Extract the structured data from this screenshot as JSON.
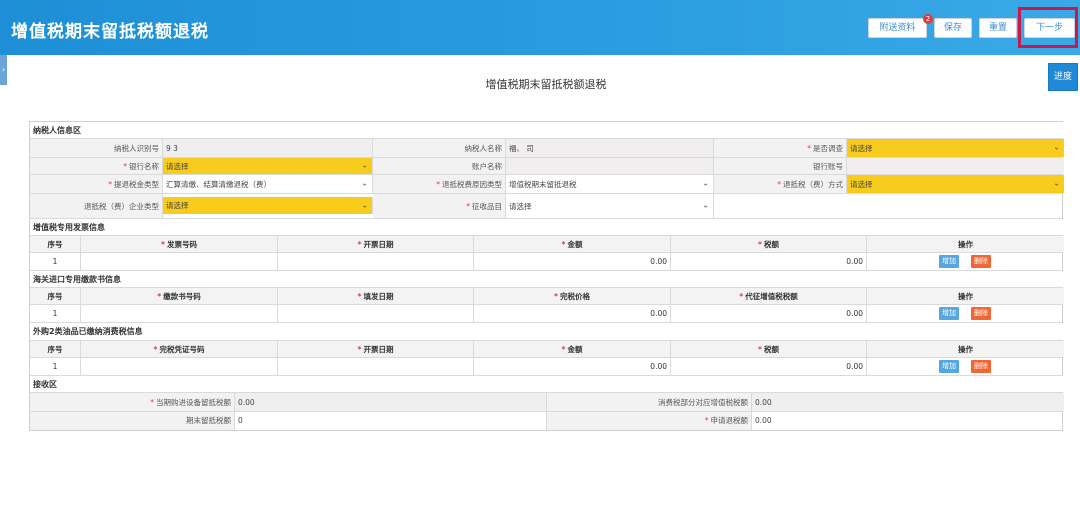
{
  "header": {
    "title": "增值税期末留抵税额退税",
    "buttons": {
      "attach": "附送资料",
      "save": "保存",
      "reset": "重置",
      "next": "下一步"
    },
    "attach_badge": "2"
  },
  "page_title": "增值税期末留抵税额退税",
  "progress_button": "进度",
  "side_handle": "›",
  "taxpayer": {
    "section": "纳税人信息区",
    "tax_id_label": "纳税人识别号",
    "tax_id_value": "9            3",
    "name_label": "纳税人名称",
    "name_value": "福、                         司",
    "audit_label": "是否调查",
    "audit_value": "请选择",
    "bank_label": "银行名称",
    "bank_value": "请选择",
    "account_name_label": "账户名称",
    "account_name_value": "",
    "bank_account_label": "银行账号",
    "bank_account_value": "",
    "refund_type_label": "提退税金类型",
    "refund_type_value": "汇算清缴、结算清缴退税（费）",
    "reason_type_label": "退抵税费原因类型",
    "reason_type_value": "增值税期末留抵退税",
    "refund_method_label": "退抵税（费）方式",
    "refund_method_value": "请选择",
    "enterprise_type_label": "退抵税（费）企业类型",
    "enterprise_type_value": "请选择",
    "levy_item_label": "征收品目",
    "levy_item_value": "请选择"
  },
  "invoice": {
    "section": "增值税专用发票信息",
    "headers": [
      "序号",
      "发票号码",
      "开票日期",
      "金额",
      "税额",
      "操作"
    ],
    "row": {
      "index": "1",
      "amount": "0.00",
      "tax": "0.00"
    }
  },
  "customs": {
    "section": "海关进口专用缴款书信息",
    "headers": [
      "序号",
      "缴款书号码",
      "填发日期",
      "完税价格",
      "代征增值税税额",
      "操作"
    ],
    "row": {
      "index": "1",
      "amount": "0.00",
      "tax": "0.00"
    }
  },
  "oil": {
    "section": "外购2类油品已缴纳消费税信息",
    "headers": [
      "序号",
      "完税凭证号码",
      "开票日期",
      "金额",
      "税额",
      "操作"
    ],
    "row": {
      "index": "1",
      "amount": "0.00",
      "tax": "0.00"
    }
  },
  "actions": {
    "add": "增加",
    "delete": "删除"
  },
  "receive": {
    "section": "接收区",
    "equip_label": "当期购进设备留抵税额",
    "equip_value": "0.00",
    "consumption_label": "消费税部分对应增值税税额",
    "consumption_value": "0.00",
    "end_label": "期末留抵税额",
    "end_value": "0",
    "apply_label": "申请退税额",
    "apply_value": "0.00"
  },
  "colors": {
    "header_blue": "#2a9ee0",
    "required_yellow": "#f8cc1c",
    "highlight_red": "#c8194f",
    "add_blue": "#55a7e0",
    "delete_orange": "#f06733"
  },
  "icons": {
    "dropdown": "chevron-down-icon"
  }
}
